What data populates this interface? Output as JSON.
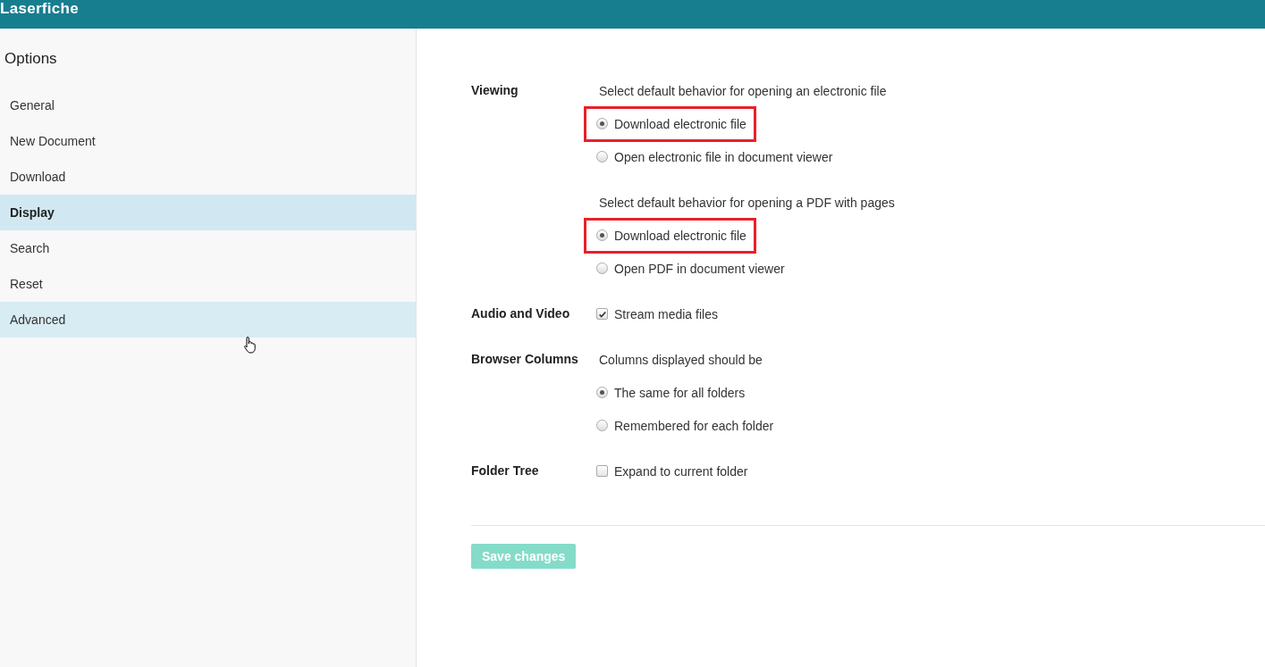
{
  "header": {
    "logo": "Laserfiche"
  },
  "sidebar": {
    "title": "Options",
    "items": [
      {
        "label": "General",
        "selected": false,
        "hovered": false
      },
      {
        "label": "New Document",
        "selected": false,
        "hovered": false
      },
      {
        "label": "Download",
        "selected": false,
        "hovered": false
      },
      {
        "label": "Display",
        "selected": true,
        "hovered": false
      },
      {
        "label": "Search",
        "selected": false,
        "hovered": false
      },
      {
        "label": "Reset",
        "selected": false,
        "hovered": false
      },
      {
        "label": "Advanced",
        "selected": false,
        "hovered": true
      }
    ]
  },
  "sections": [
    {
      "label": "Viewing",
      "groups": [
        {
          "prompt": "Select default behavior for opening an electronic file",
          "options": [
            {
              "kind": "radio",
              "label": "Download electronic file",
              "checked": true,
              "highlighted": true
            },
            {
              "kind": "radio",
              "label": "Open electronic file in document viewer",
              "checked": false,
              "highlighted": false
            }
          ]
        },
        {
          "prompt": "Select default behavior for opening a PDF with pages",
          "options": [
            {
              "kind": "radio",
              "label": "Download electronic file",
              "checked": true,
              "highlighted": true
            },
            {
              "kind": "radio",
              "label": "Open PDF in document viewer",
              "checked": false,
              "highlighted": false
            }
          ]
        }
      ]
    },
    {
      "label": "Audio and Video",
      "groups": [
        {
          "options": [
            {
              "kind": "checkbox",
              "label": "Stream media files",
              "checked": true,
              "highlighted": false
            }
          ]
        }
      ]
    },
    {
      "label": "Browser Columns",
      "groups": [
        {
          "prompt": "Columns displayed should be",
          "options": [
            {
              "kind": "radio",
              "label": "The same for all folders",
              "checked": true,
              "highlighted": false
            },
            {
              "kind": "radio",
              "label": "Remembered for each folder",
              "checked": false,
              "highlighted": false
            }
          ]
        }
      ]
    },
    {
      "label": "Folder Tree",
      "groups": [
        {
          "options": [
            {
              "kind": "checkbox",
              "label": "Expand to current folder",
              "checked": false,
              "highlighted": false
            }
          ]
        }
      ]
    }
  ],
  "save_button": {
    "label": "Save changes",
    "disabled": true
  }
}
